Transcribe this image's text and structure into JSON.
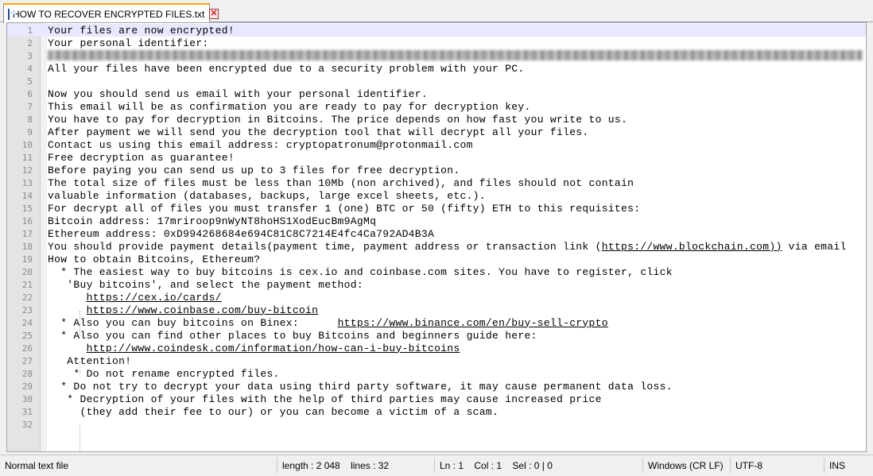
{
  "tab": {
    "title": "HOW TO RECOVER ENCRYPTED FILES.txt",
    "close": "✕"
  },
  "editor": {
    "current_line": 1,
    "lines": [
      {
        "n": "1",
        "text": "Your files are now encrypted!"
      },
      {
        "n": "2",
        "text": "Your personal identifier:"
      },
      {
        "n": "3",
        "text": "",
        "blurred": true
      },
      {
        "n": "4",
        "text": "All your files have been encrypted due to a security problem with your PC."
      },
      {
        "n": "5",
        "text": ""
      },
      {
        "n": "6",
        "text": "Now you should send us email with your personal identifier."
      },
      {
        "n": "7",
        "text": "This email will be as confirmation you are ready to pay for decryption key."
      },
      {
        "n": "8",
        "text": "You have to pay for decryption in Bitcoins. The price depends on how fast you write to us."
      },
      {
        "n": "9",
        "text": "After payment we will send you the decryption tool that will decrypt all your files."
      },
      {
        "n": "10",
        "text": "Contact us using this email address: cryptopatronum@protonmail.com"
      },
      {
        "n": "11",
        "text": "Free decryption as guarantee!"
      },
      {
        "n": "12",
        "text": "Before paying you can send us up to 3 files for free decryption."
      },
      {
        "n": "13",
        "text": "The total size of files must be less than 10Mb (non archived), and files should not contain"
      },
      {
        "n": "14",
        "text": "valuable information (databases, backups, large excel sheets, etc.)."
      },
      {
        "n": "15",
        "text": "For decrypt all of files you must transfer 1 (one) BTC or 50 (fifty) ETH to this requisites:"
      },
      {
        "n": "16",
        "text": "Bitcoin address: 17mriroop9nWyNT8hoHS1XodEucBm9AgMq"
      },
      {
        "n": "17",
        "text": "Ethereum address: 0xD994268684e694C81C8C7214E4fc4Ca792AD4B3A"
      },
      {
        "n": "18",
        "pre": "You should provide payment details(payment time, payment address or transaction link (",
        "link": "https://www.blockchain.com))",
        "post": " via email"
      },
      {
        "n": "19",
        "text": "How to obtain Bitcoins, Ethereum?"
      },
      {
        "n": "20",
        "text": "  * The easiest way to buy bitcoins is cex.io and coinbase.com sites. You have to register, click"
      },
      {
        "n": "21",
        "text": "   'Buy bitcoins', and select the payment method:"
      },
      {
        "n": "22",
        "pre": "      ",
        "link": "https://cex.io/cards/",
        "post": ""
      },
      {
        "n": "23",
        "pre": "      ",
        "link": "https://www.coinbase.com/buy-bitcoin",
        "post": ""
      },
      {
        "n": "24",
        "pre": "  * Also you can buy bitcoins on Binex:      ",
        "link": "https://www.binance.com/en/buy-sell-crypto",
        "post": ""
      },
      {
        "n": "25",
        "text": "  * Also you can find other places to buy Bitcoins and beginners guide here:"
      },
      {
        "n": "26",
        "pre": "      ",
        "link": "http://www.coindesk.com/information/how-can-i-buy-bitcoins",
        "post": ""
      },
      {
        "n": "27",
        "text": "   Attention!"
      },
      {
        "n": "28",
        "text": "    * Do not rename encrypted files."
      },
      {
        "n": "29",
        "text": "  * Do not try to decrypt your data using third party software, it may cause permanent data loss."
      },
      {
        "n": "30",
        "text": "   * Decryption of your files with the help of third parties may cause increased price"
      },
      {
        "n": "31",
        "text": "     (they add their fee to our) or you can become a victim of a scam."
      },
      {
        "n": "32",
        "text": ""
      }
    ]
  },
  "statusbar": {
    "file_type": "Normal text file",
    "length": "length : 2 048",
    "lines": "lines : 32",
    "ln": "Ln : 1",
    "col": "Col : 1",
    "sel": "Sel : 0 | 0",
    "eol": "Windows (CR LF)",
    "encoding": "UTF-8",
    "mode": "INS"
  }
}
